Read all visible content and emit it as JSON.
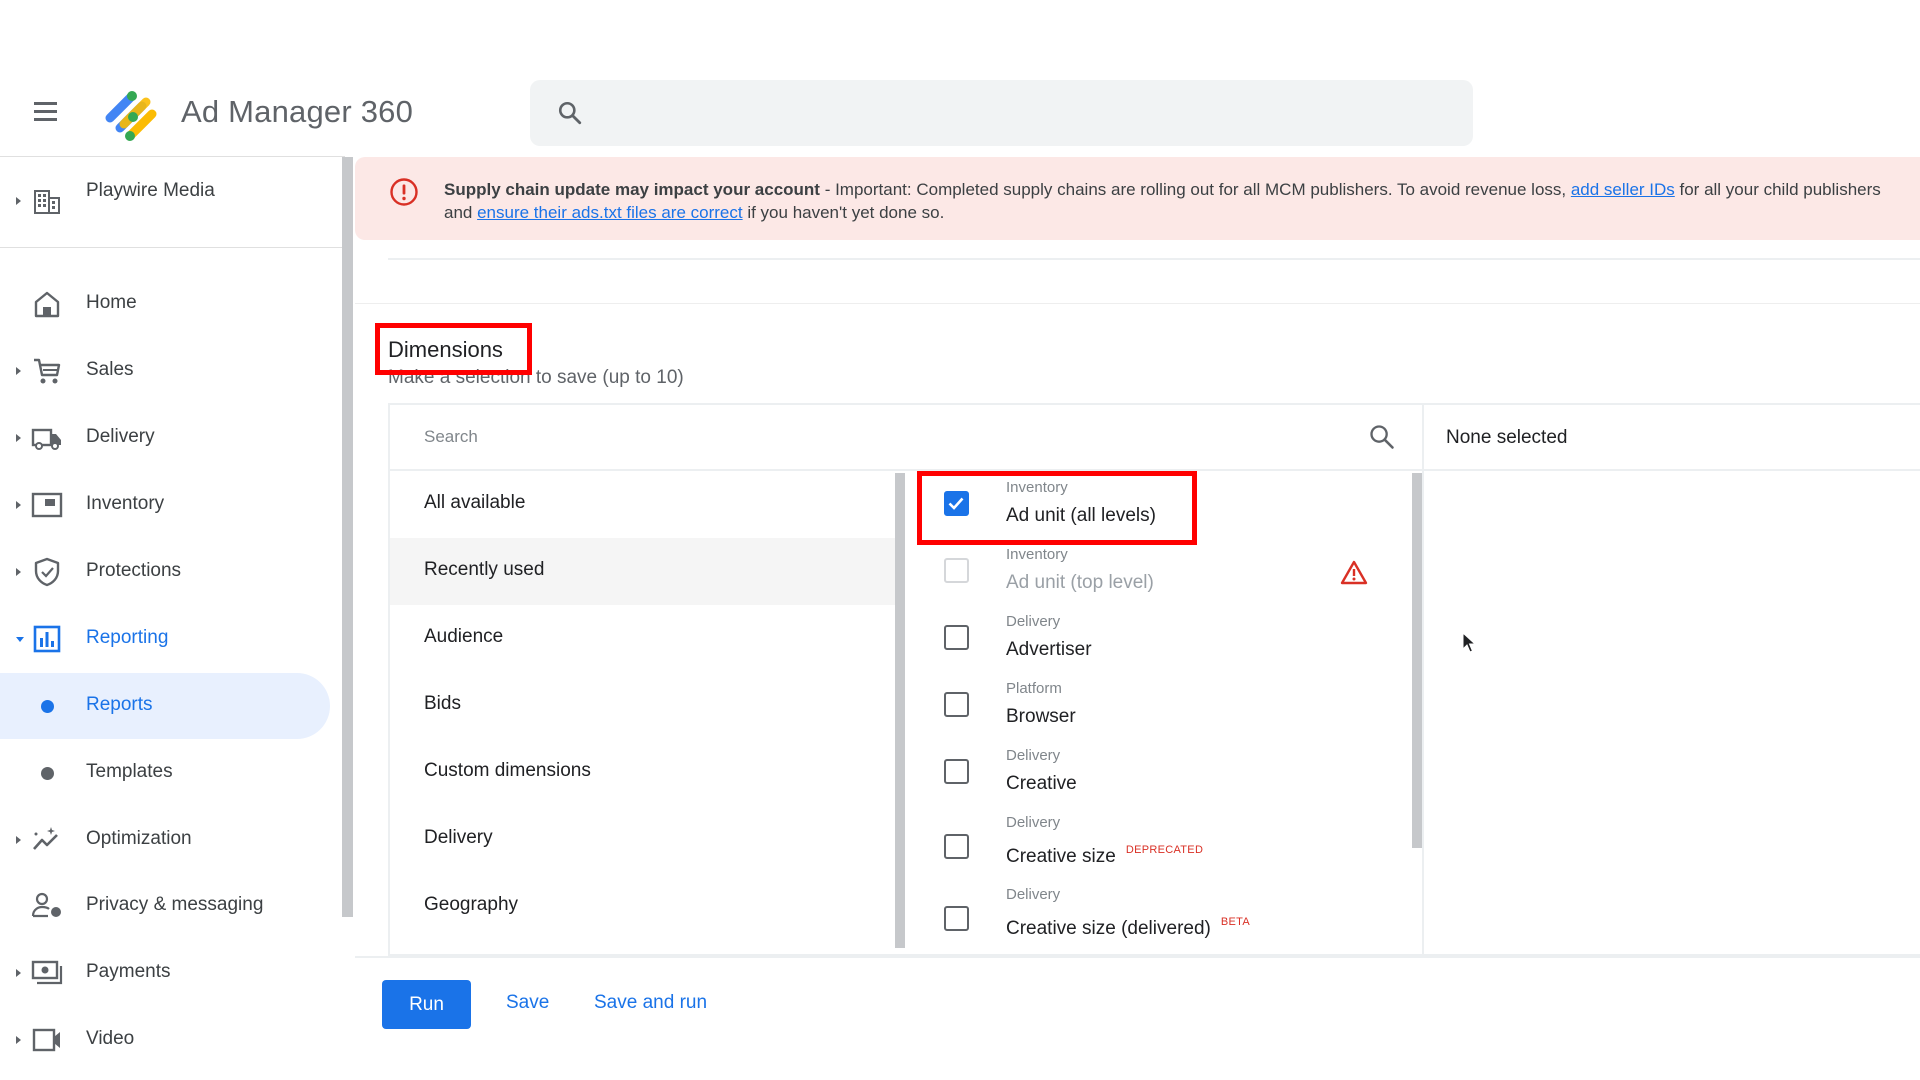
{
  "header": {
    "app_title": "Ad Manager 360",
    "menu_icon": "hamburger-menu-icon",
    "search_icon": "search-icon",
    "search_placeholder": ""
  },
  "sidebar": {
    "account": {
      "name": "Playwire Media",
      "icon": "building-icon"
    },
    "items": [
      {
        "label": "Home",
        "icon": "home-icon",
        "expandable": false
      },
      {
        "label": "Sales",
        "icon": "cart-icon",
        "expandable": true
      },
      {
        "label": "Delivery",
        "icon": "truck-icon",
        "expandable": true
      },
      {
        "label": "Inventory",
        "icon": "inventory-icon",
        "expandable": true
      },
      {
        "label": "Protections",
        "icon": "shield-icon",
        "expandable": true
      },
      {
        "label": "Reporting",
        "icon": "bar-chart-icon",
        "expandable": true,
        "expanded": true
      },
      {
        "label": "Reports",
        "sub": true,
        "selected": true
      },
      {
        "label": "Templates",
        "sub": true
      },
      {
        "label": "Optimization",
        "icon": "sparkle-trend-icon",
        "expandable": true
      },
      {
        "label": "Privacy & messaging",
        "icon": "privacy-icon",
        "expandable": false
      },
      {
        "label": "Payments",
        "icon": "payments-icon",
        "expandable": true
      },
      {
        "label": "Video",
        "icon": "video-icon",
        "expandable": true
      }
    ]
  },
  "banner": {
    "icon": "error-icon",
    "title": "Supply chain update may impact your account",
    "text_1": " - Important: Completed supply chains are rolling out for all MCM publishers. To avoid revenue loss, ",
    "link_1": "add seller IDs",
    "text_2": " for all your child publishers",
    "line2_prefix": "and ",
    "link_2": "ensure their ads.txt files are correct",
    "text_3": " if you haven't yet done so.",
    "colors": {
      "background": "#fce8e6",
      "icon": "#d93025",
      "link": "#1a73e8"
    }
  },
  "dimensions": {
    "title": "Dimensions",
    "subtitle": "Make a selection to save (up to 10)",
    "search_placeholder": "Search",
    "selected_header": "None selected",
    "categories": [
      {
        "label": "All available"
      },
      {
        "label": "Recently used",
        "hover": true
      },
      {
        "label": "Audience"
      },
      {
        "label": "Bids"
      },
      {
        "label": "Custom dimensions"
      },
      {
        "label": "Delivery"
      },
      {
        "label": "Geography"
      }
    ],
    "items": [
      {
        "category": "Inventory",
        "name": "Ad unit (all levels)",
        "checked": true,
        "disabled": false,
        "badge": ""
      },
      {
        "category": "Inventory",
        "name": "Ad unit (top level)",
        "checked": false,
        "disabled": true,
        "badge": "",
        "warning": true
      },
      {
        "category": "Delivery",
        "name": "Advertiser",
        "checked": false,
        "disabled": false,
        "badge": ""
      },
      {
        "category": "Platform",
        "name": "Browser",
        "checked": false,
        "disabled": false,
        "badge": ""
      },
      {
        "category": "Delivery",
        "name": "Creative",
        "checked": false,
        "disabled": false,
        "badge": ""
      },
      {
        "category": "Delivery",
        "name": "Creative size",
        "checked": false,
        "disabled": false,
        "badge": "DEPRECATED"
      },
      {
        "category": "Delivery",
        "name": "Creative size (delivered)",
        "checked": false,
        "disabled": false,
        "badge": "BETA"
      }
    ]
  },
  "footer": {
    "run_label": "Run",
    "save_label": "Save",
    "save_and_run_label": "Save and run"
  },
  "colors": {
    "accent": "#1a73e8",
    "annotation_box": "#ff0000",
    "selected_nav_bg": "#e8f0fe"
  }
}
